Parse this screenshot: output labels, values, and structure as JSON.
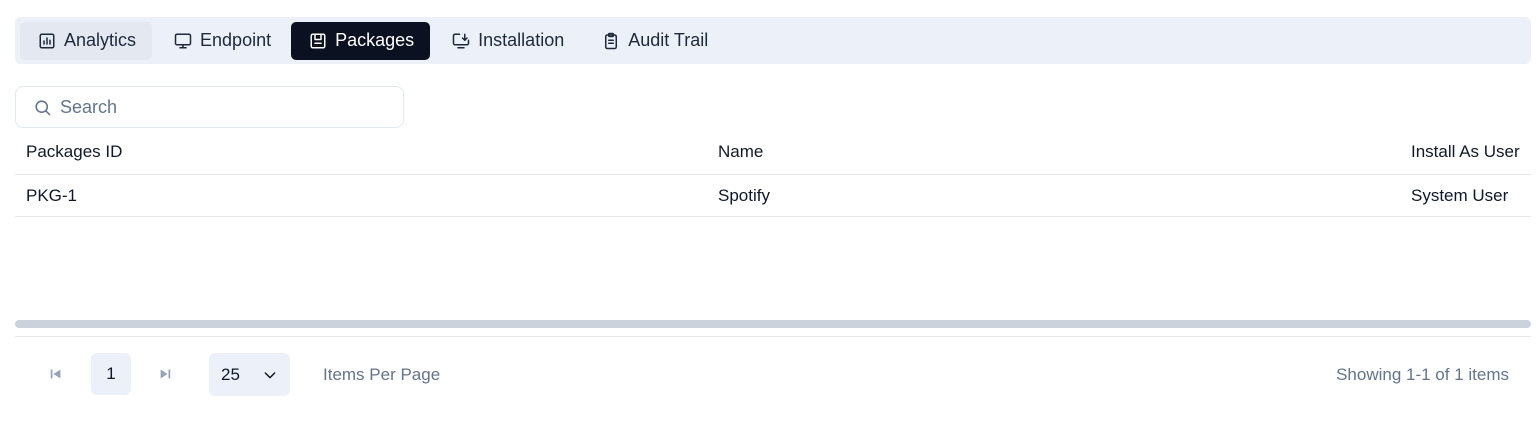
{
  "tabs": [
    {
      "label": "Analytics",
      "icon": "chart-icon"
    },
    {
      "label": "Endpoint",
      "icon": "monitor-icon"
    },
    {
      "label": "Packages",
      "icon": "package-icon"
    },
    {
      "label": "Installation",
      "icon": "install-icon"
    },
    {
      "label": "Audit Trail",
      "icon": "clipboard-icon"
    }
  ],
  "active_tab": "Packages",
  "search": {
    "placeholder": "Search",
    "value": ""
  },
  "table": {
    "columns": [
      "Packages ID",
      "Name",
      "Install As User"
    ],
    "rows": [
      [
        "PKG-1",
        "Spotify",
        "System User"
      ]
    ]
  },
  "pagination": {
    "page": "1",
    "per_page": "25",
    "per_page_label": "Items Per Page",
    "showing": "Showing 1-1 of 1 items"
  },
  "colors": {
    "tab_bar_bg": "#ecf0f8",
    "active_tab_bg": "#0b1120",
    "muted_text": "#64748b"
  }
}
